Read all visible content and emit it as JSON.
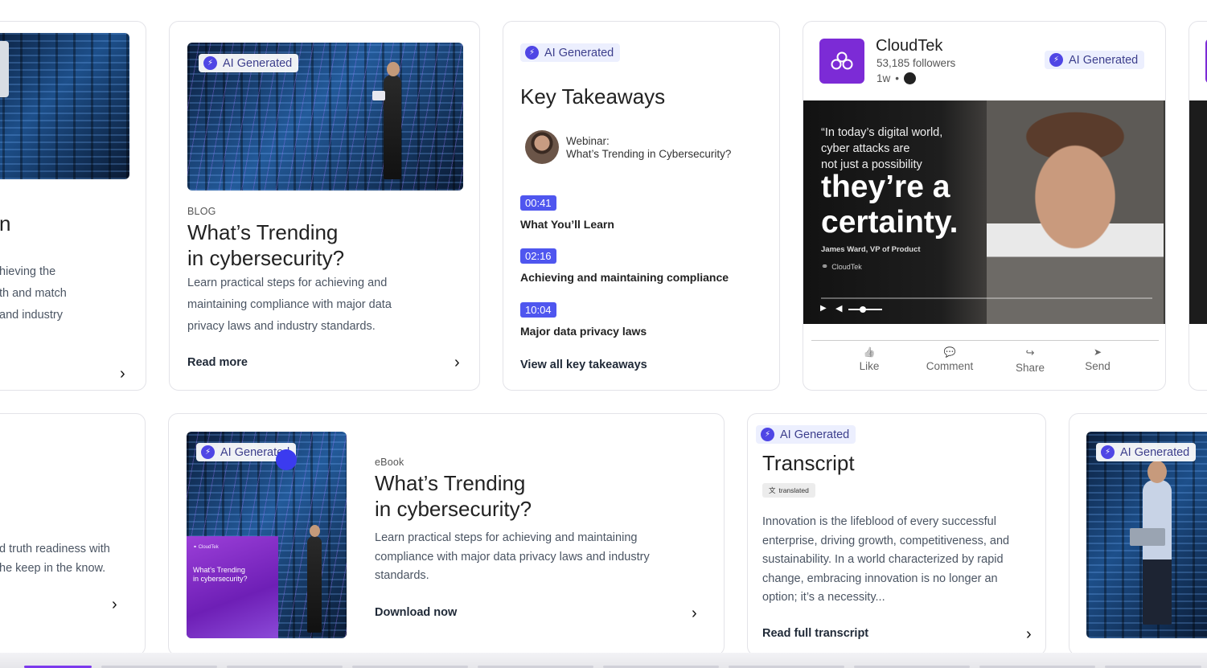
{
  "ai_badge_label": "AI Generated",
  "card_left_top": {
    "title_fragment": "n",
    "body_lines": [
      "hieving the",
      "th and match",
      "and industry"
    ]
  },
  "card_blog": {
    "category": "BLOG",
    "title_line1": "What’s Trending",
    "title_line2": "in cybersecurity?",
    "body_lines": [
      "Learn practical steps for achieving and",
      "maintaining compliance with major data",
      "privacy laws and industry standards."
    ],
    "cta": "Read more"
  },
  "card_takeaways": {
    "title": "Key Takeaways",
    "webinar_line1": "Webinar:",
    "webinar_line2": "What’s Trending in Cybersecurity?",
    "items": [
      {
        "time": "00:41",
        "label": "What You’ll Learn"
      },
      {
        "time": "02:16",
        "label": "Achieving and maintaining compliance"
      },
      {
        "time": "10:04",
        "label": "Major data privacy laws"
      }
    ],
    "cta": "View all key takeaways"
  },
  "card_social": {
    "company": "CloudTek",
    "followers": "53,185 followers",
    "age": "1w",
    "age_sep": "•",
    "quote_line1": "“In today’s digital world,",
    "quote_line2": "cyber attacks are",
    "quote_line3": "not just a possibility",
    "big_line1": "they’re a",
    "big_line2": "certainty.",
    "attribution": "James Ward, VP of Product",
    "logo_text": "CloudTek",
    "actions": [
      {
        "label": "Like",
        "icon": "thumbs-up-icon",
        "glyph": "👍"
      },
      {
        "label": "Comment",
        "icon": "comment-icon",
        "glyph": "💬"
      },
      {
        "label": "Share",
        "icon": "share-icon",
        "glyph": "↪"
      },
      {
        "label": "Send",
        "icon": "send-icon",
        "glyph": "➤"
      }
    ]
  },
  "card_left_bottom": {
    "body_lines": [
      "d truth readiness with",
      "he keep in the know."
    ]
  },
  "card_ebook": {
    "category": "eBook",
    "title_line1": "What’s Trending",
    "title_line2": "in cybersecurity?",
    "body_lines": [
      "Learn practical steps for achieving and maintaining",
      "compliance with major data privacy laws and industry",
      "standards."
    ],
    "cta": "Download now",
    "cover_title_line1": "What’s Trending",
    "cover_title_line2": "in cybersecurity?"
  },
  "card_transcript": {
    "title": "Transcript",
    "tag": "translated",
    "body_lines": [
      "Innovation is the lifeblood of every successful",
      "enterprise, driving growth, competitiveness, and",
      "sustainability. In a world characterized by rapid",
      "change, embracing innovation is no longer an",
      "option; it’s a necessity..."
    ],
    "cta": "Read full transcript"
  },
  "colors": {
    "accent": "#4f46e5",
    "badge_bg": "#eceffe",
    "brand_purple": "#7c2bd6",
    "timestamp_bg": "#4f56ef"
  }
}
